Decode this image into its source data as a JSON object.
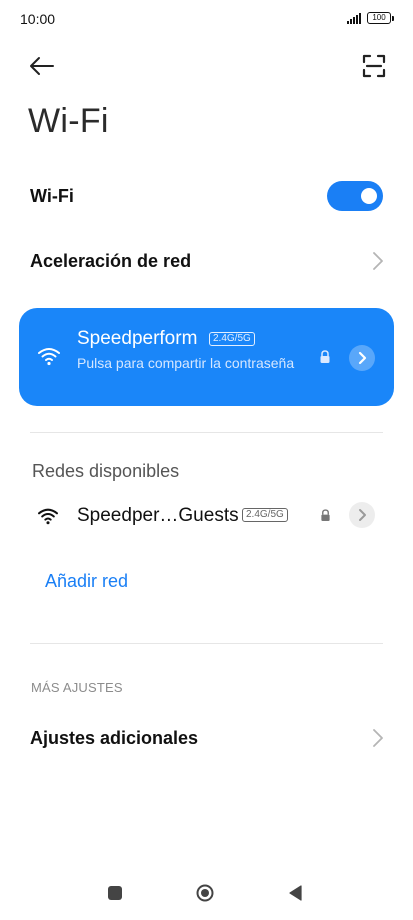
{
  "status_bar": {
    "time": "10:00",
    "battery": "100"
  },
  "header": {
    "title": "Wi-Fi"
  },
  "icons": {
    "back": "back-arrow-icon",
    "scan": "qr-scan-icon",
    "wifi": "wifi-icon",
    "lock": "lock-icon",
    "chevron": "chevron-right-icon"
  },
  "wifi_toggle": {
    "label": "Wi-Fi",
    "state": "on"
  },
  "network_acceleration": {
    "label": "Aceleración de red"
  },
  "connected_network": {
    "ssid": "Speedperform",
    "band": "2.4G/5G",
    "subtitle": "Pulsa para compartir la contraseña"
  },
  "available": {
    "title": "Redes disponibles",
    "networks": [
      {
        "ssid": "Speedper…Guests",
        "band": "2.4G/5G"
      }
    ]
  },
  "add_network": {
    "label": "Añadir red"
  },
  "more_settings": {
    "title": "MÁS AJUSTES",
    "items": [
      {
        "label": "Ajustes adicionales"
      }
    ]
  },
  "colors": {
    "accent": "#1a7ff5",
    "card_bg": "#1a86f9",
    "background": "#ffffff"
  }
}
